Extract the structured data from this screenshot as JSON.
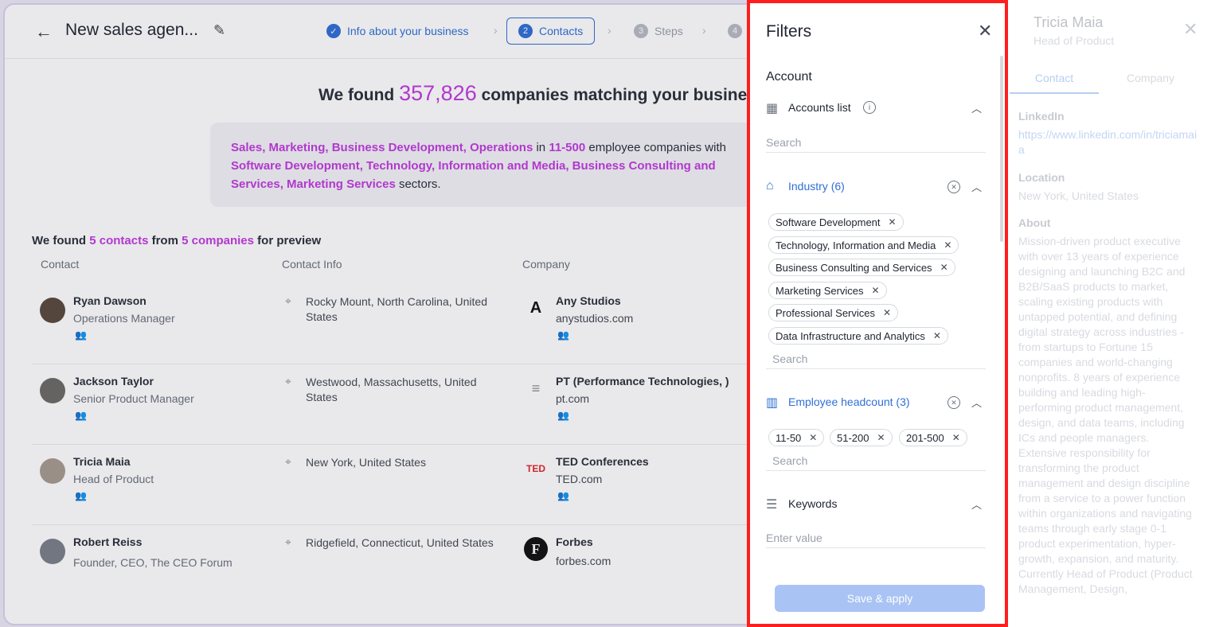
{
  "header": {
    "title": "New sales agen...",
    "steps": [
      {
        "num": "",
        "label": "Info about your business"
      },
      {
        "num": "2",
        "label": "Contacts"
      },
      {
        "num": "3",
        "label": "Steps"
      },
      {
        "num": "4",
        "label": ""
      }
    ]
  },
  "headline": {
    "prefix": "We found",
    "count": "357,826",
    "suffix": "companies matching your business"
  },
  "summary": {
    "departments": "Sales, Marketing, Business Development, Operations",
    "in": "in",
    "size": "11-500",
    "mid": "employee companies with",
    "sectors": "Software Development, Technology, Information and Media, Business Consulting and Services, Marketing Services",
    "end": "sectors."
  },
  "preview": {
    "prefix": "We found",
    "contacts": "5 contacts",
    "from": "from",
    "companies": "5 companies",
    "suffix": "for preview",
    "columns": [
      "Contact",
      "Contact Info",
      "Company"
    ],
    "rows": [
      {
        "name": "Ryan Dawson",
        "title": "Operations Manager",
        "location": "Rocky Mount, North Carolina, United States",
        "company": "Any Studios",
        "domain": "anystudios.com",
        "logo": "A"
      },
      {
        "name": "Jackson Taylor",
        "title": "Senior Product Manager",
        "location": "Westwood, Massachusetts, United States",
        "company": "PT (Performance Technologies, )",
        "domain": "pt.com",
        "logo": "≡"
      },
      {
        "name": "Tricia Maia",
        "title": "Head of Product",
        "location": "New York, United States",
        "company": "TED Conferences",
        "domain": "TED.com",
        "logo": "TED"
      },
      {
        "name": "Robert Reiss",
        "title": "Founder, CEO, The CEO Forum",
        "location": "Ridgefield, Connecticut, United States",
        "company": "Forbes",
        "domain": "forbes.com",
        "logo": "F"
      }
    ]
  },
  "detail": {
    "name": "Tricia Maia",
    "role": "Head of Product",
    "tabs": [
      "Contact",
      "Company"
    ],
    "linkedin_label": "LinkedIn",
    "linkedin": "https://www.linkedin.com/in/triciamaia",
    "location_label": "Location",
    "location": "New York, United States",
    "about_label": "About",
    "about": "Mission-driven product executive with over 13 years of experience designing and launching B2C and B2B/SaaS products to market, scaling existing products with untapped potential, and defining digital strategy across industries - from startups to Fortune 15 companies and world-changing nonprofits. 8 years of experience building and leading high-performing product management, design, and data teams, including ICs and people managers. Extensive responsibility for transforming the product management and design discipline from a service to a power function within organizations and navigating teams through early stage 0-1 product experimentation, hyper-growth, expansion, and maturity. Currently Head of Product (Product Management, Design,"
  },
  "filters": {
    "title": "Filters",
    "section": "Account",
    "accounts_list": {
      "label": "Accounts list",
      "placeholder": "Search"
    },
    "industry": {
      "label": "Industry (6)",
      "tags": [
        "Software Development",
        "Technology, Information and Media",
        "Business Consulting and Services",
        "Marketing Services",
        "Professional Services",
        "Data Infrastructure and Analytics"
      ],
      "placeholder": "Search"
    },
    "headcount": {
      "label": "Employee headcount (3)",
      "tags": [
        "11-50",
        "51-200",
        "201-500"
      ],
      "placeholder": "Search"
    },
    "keywords": {
      "label": "Keywords",
      "placeholder": "Enter value"
    },
    "save_label": "Save & apply"
  },
  "colors": {
    "accent": "#2f6fd6",
    "highlight": "#c13adf",
    "frame": "#ff1e1e"
  }
}
